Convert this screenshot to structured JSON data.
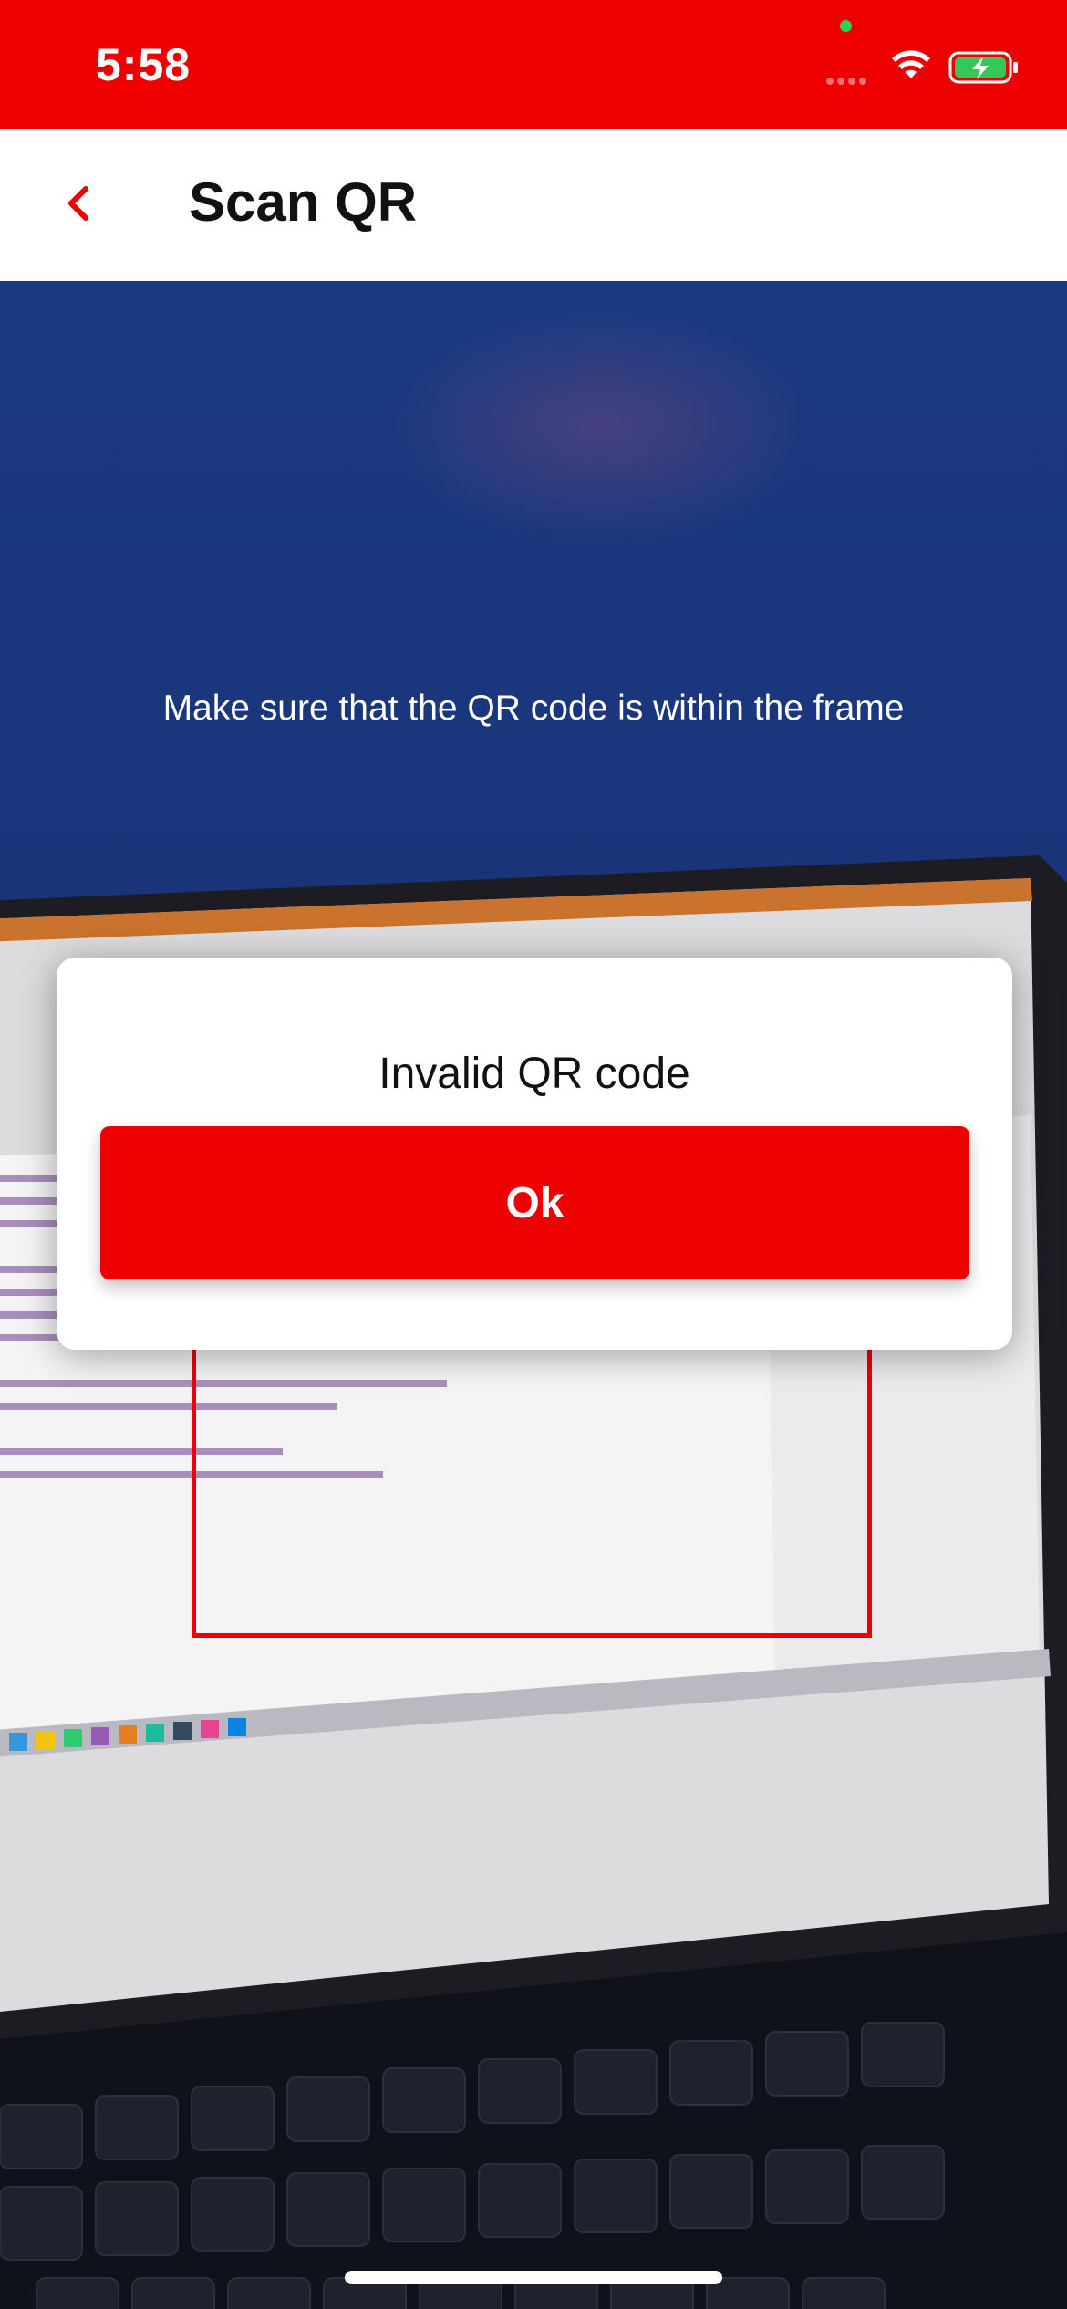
{
  "status_bar": {
    "time": "5:58",
    "wifi_icon": "wifi-icon",
    "battery_icon": "battery-charging-icon",
    "background_color": "#ee0000"
  },
  "nav": {
    "title": "Scan QR",
    "back_icon": "chevron-left-icon",
    "accent_color": "#ee0000"
  },
  "scanner": {
    "hint": "Make sure that the QR code is within the frame",
    "frame_color": "#ee0000"
  },
  "dialog": {
    "message": "Invalid QR code",
    "ok_label": "Ok",
    "button_color": "#ee0000"
  }
}
